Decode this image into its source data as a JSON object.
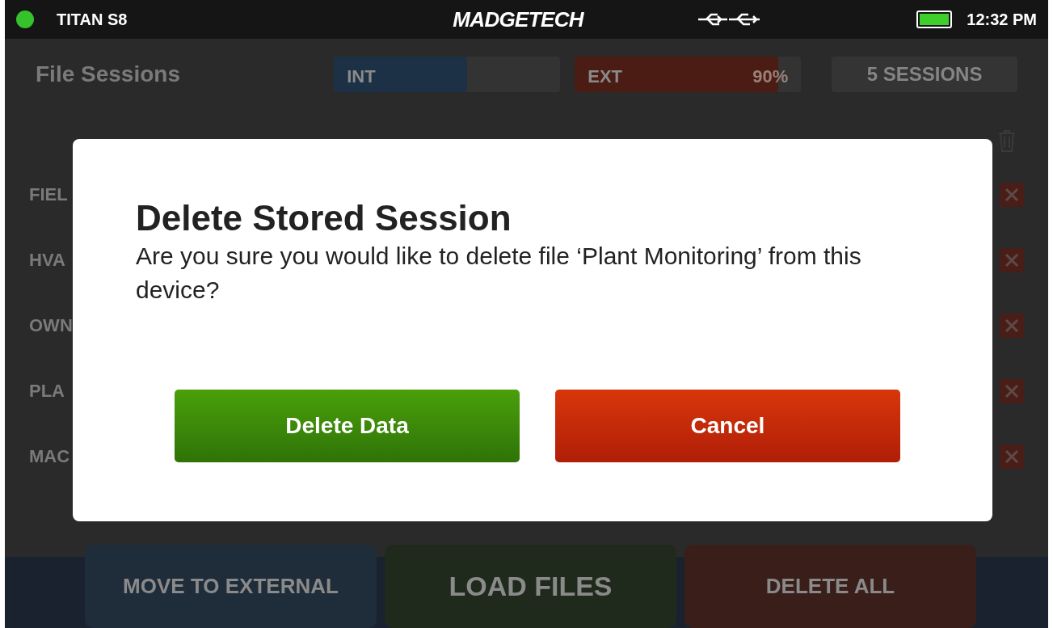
{
  "status_bar": {
    "device": "TITAN S8",
    "connected": true,
    "brand": "MADGETECH",
    "time": "12:32 PM"
  },
  "screen": {
    "title": "File Sessions",
    "storage": [
      {
        "kind": "internal",
        "label": "INT",
        "level": 0.59
      },
      {
        "kind": "external",
        "label": "EXT",
        "level": 0.9,
        "reading": "90%"
      }
    ],
    "session_count": "5 SESSIONS",
    "rows": [
      {
        "name": "FIEL"
      },
      {
        "name": "HVA"
      },
      {
        "name": "OWN"
      },
      {
        "name": "PLA"
      },
      {
        "name": "MAC"
      }
    ],
    "actions": [
      {
        "kind": "move",
        "label": "MOVE TO EXTERNAL"
      },
      {
        "kind": "load",
        "label": "LOAD FILES"
      },
      {
        "kind": "delete",
        "label": "DELETE ALL"
      }
    ]
  },
  "dialog": {
    "title": "Delete Stored Session",
    "message": "Are you sure you would like to delete file ‘Plant Monitoring’ from this device?",
    "buttons": [
      {
        "kind": "confirm",
        "label": "Delete Data"
      },
      {
        "kind": "cancel",
        "label": "Cancel"
      }
    ]
  }
}
